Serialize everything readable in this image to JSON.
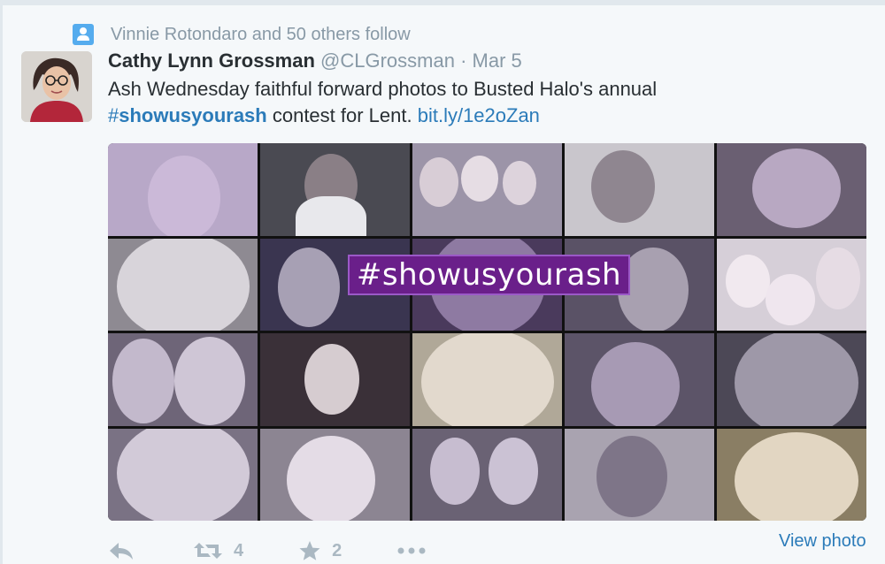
{
  "context": {
    "icon": "follow-icon",
    "text": "Vinnie Rotondaro and 50 others follow"
  },
  "tweet": {
    "name": "Cathy Lynn Grossman",
    "handle": "@CLGrossman",
    "separator": "·",
    "date": "Mar 5",
    "line1": "Ash Wednesday faithful forward photos to Busted Halo's annual",
    "hashtag_hash": "#",
    "hashtag_word": "showusyourash",
    "line2_mid": " contest for Lent. ",
    "link": "bit.ly/1e2oZan",
    "image_overlay": "#showusyourash"
  },
  "actions": {
    "reply_icon": "reply-icon",
    "retweet_icon": "retweet-icon",
    "retweet_count": "4",
    "favorite_icon": "star-icon",
    "favorite_count": "2",
    "more_icon": "more-icon"
  },
  "view_photo": "View photo",
  "colors": {
    "link": "#2b7bb9",
    "muted": "#8899a6",
    "accent_icon": "#55acee",
    "overlay_bg": "#6a1f8a"
  }
}
